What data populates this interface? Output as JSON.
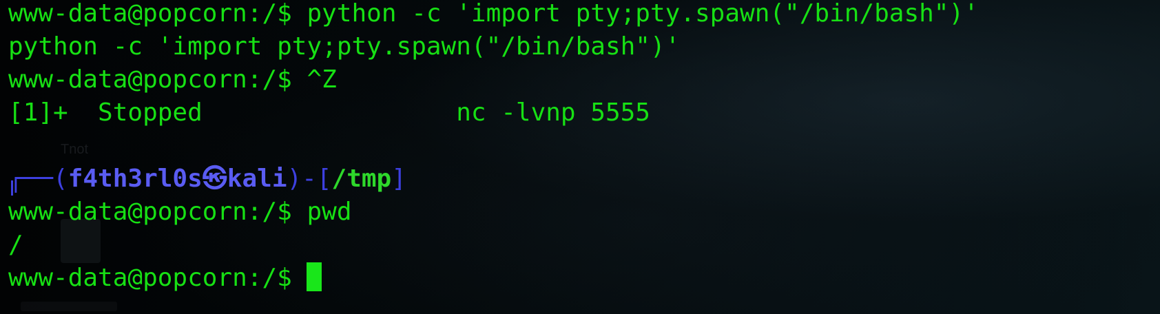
{
  "terminal": {
    "lines": {
      "l1": {
        "prompt": "www-data@popcorn:/$ ",
        "command": "python -c 'import pty;pty.spawn(\"/bin/bash\")'"
      },
      "l2": {
        "text": "python -c 'import pty;pty.spawn(\"/bin/bash\")'"
      },
      "l3": {
        "prompt": "www-data@popcorn:/$ ",
        "command": "^Z"
      },
      "l4": {
        "text": "[1]+  Stopped                 nc -lvnp 5555"
      },
      "kali_prompt": {
        "frame_start": "┌──(",
        "user": "f4th3rl0s",
        "skull": "㉿",
        "host": "kali",
        "mid": ")-[",
        "path": "/tmp",
        "end": "]"
      },
      "l7": {
        "prompt": "www-data@popcorn:/$ ",
        "command": "pwd"
      },
      "l8": {
        "text": "/"
      },
      "l9": {
        "prompt": "www-data@popcorn:/$ ",
        "command": ""
      }
    },
    "colors": {
      "text_green": "#17e014",
      "kali_blue": "#5a5cf2",
      "cursor": "#19e61a",
      "background": "#020405"
    }
  }
}
